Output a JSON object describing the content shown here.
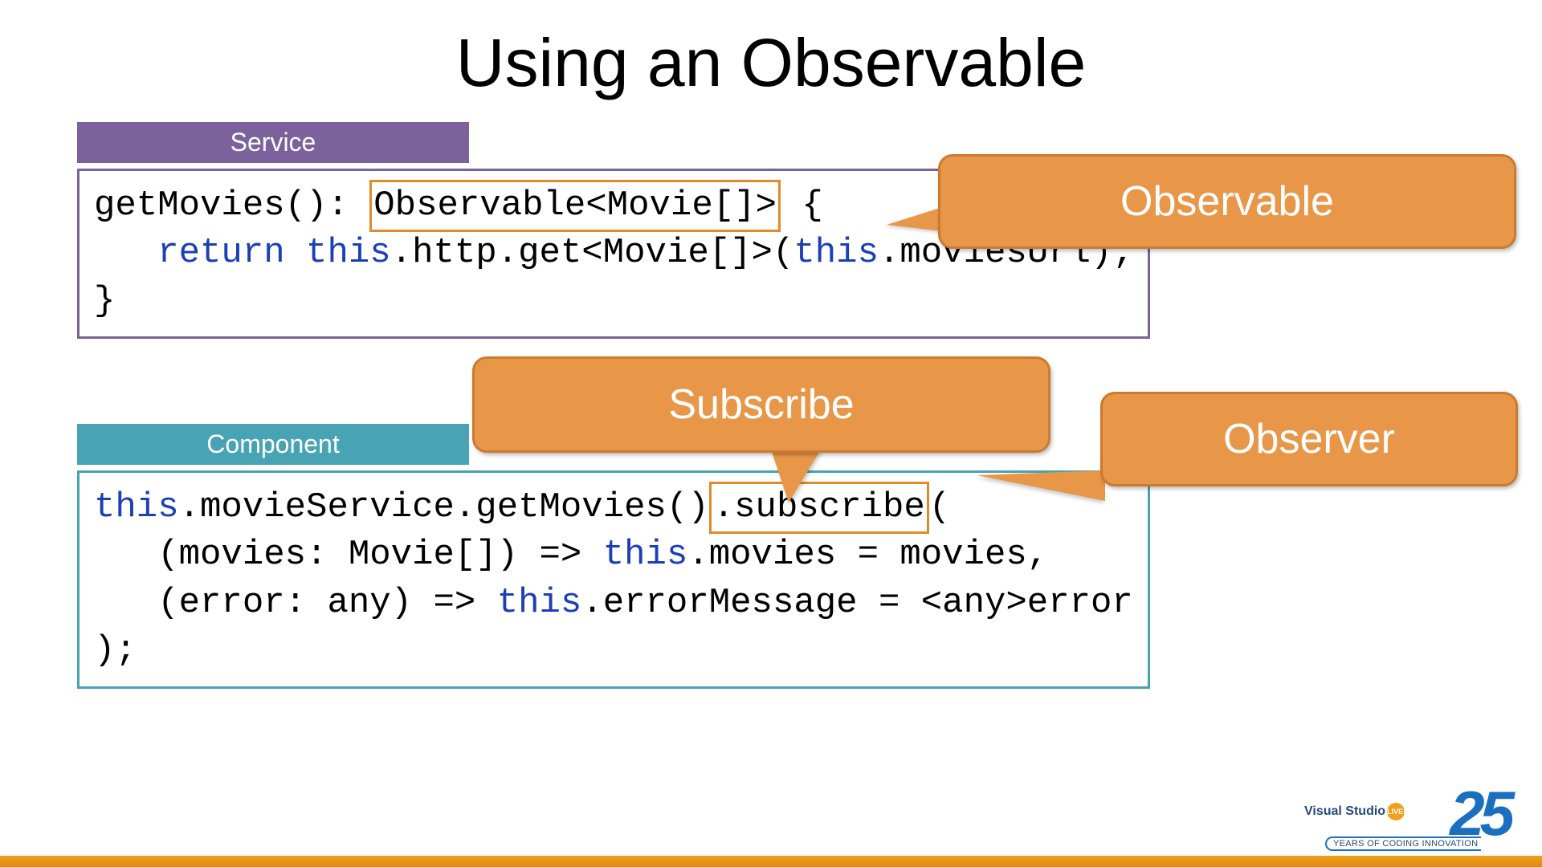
{
  "title": "Using an Observable",
  "panels": {
    "service_label": "Service",
    "component_label": "Component"
  },
  "code": {
    "service": {
      "line1_a": "getMovies(): ",
      "line1_hl": "Observable<Movie[]>",
      "line1_b": " {",
      "line2_a": "   ",
      "line2_kw": "return this",
      "line2_b": ".http.get<Movie[]>(",
      "line2_kw2": "this",
      "line2_c": ".moviesUrl);",
      "line3": "}"
    },
    "component": {
      "line1_kw": "this",
      "line1_a": ".movieService.getMovies()",
      "line1_hl": ".subscribe",
      "line1_b": "(",
      "line2_a": "   (movies: Movie[]) => ",
      "line2_kw": "this",
      "line2_b": ".movies = movies,",
      "line3_a": "   (error: any) => ",
      "line3_kw": "this",
      "line3_b": ".errorMessage = <any>error",
      "line4": ");"
    }
  },
  "callouts": {
    "observable": "Observable",
    "subscribe": "Subscribe",
    "observer": "Observer"
  },
  "logo": {
    "brand": "Visual Studio",
    "live": "LIVE!",
    "number": "25",
    "tagline": "YEARS OF CODING INNOVATION"
  }
}
